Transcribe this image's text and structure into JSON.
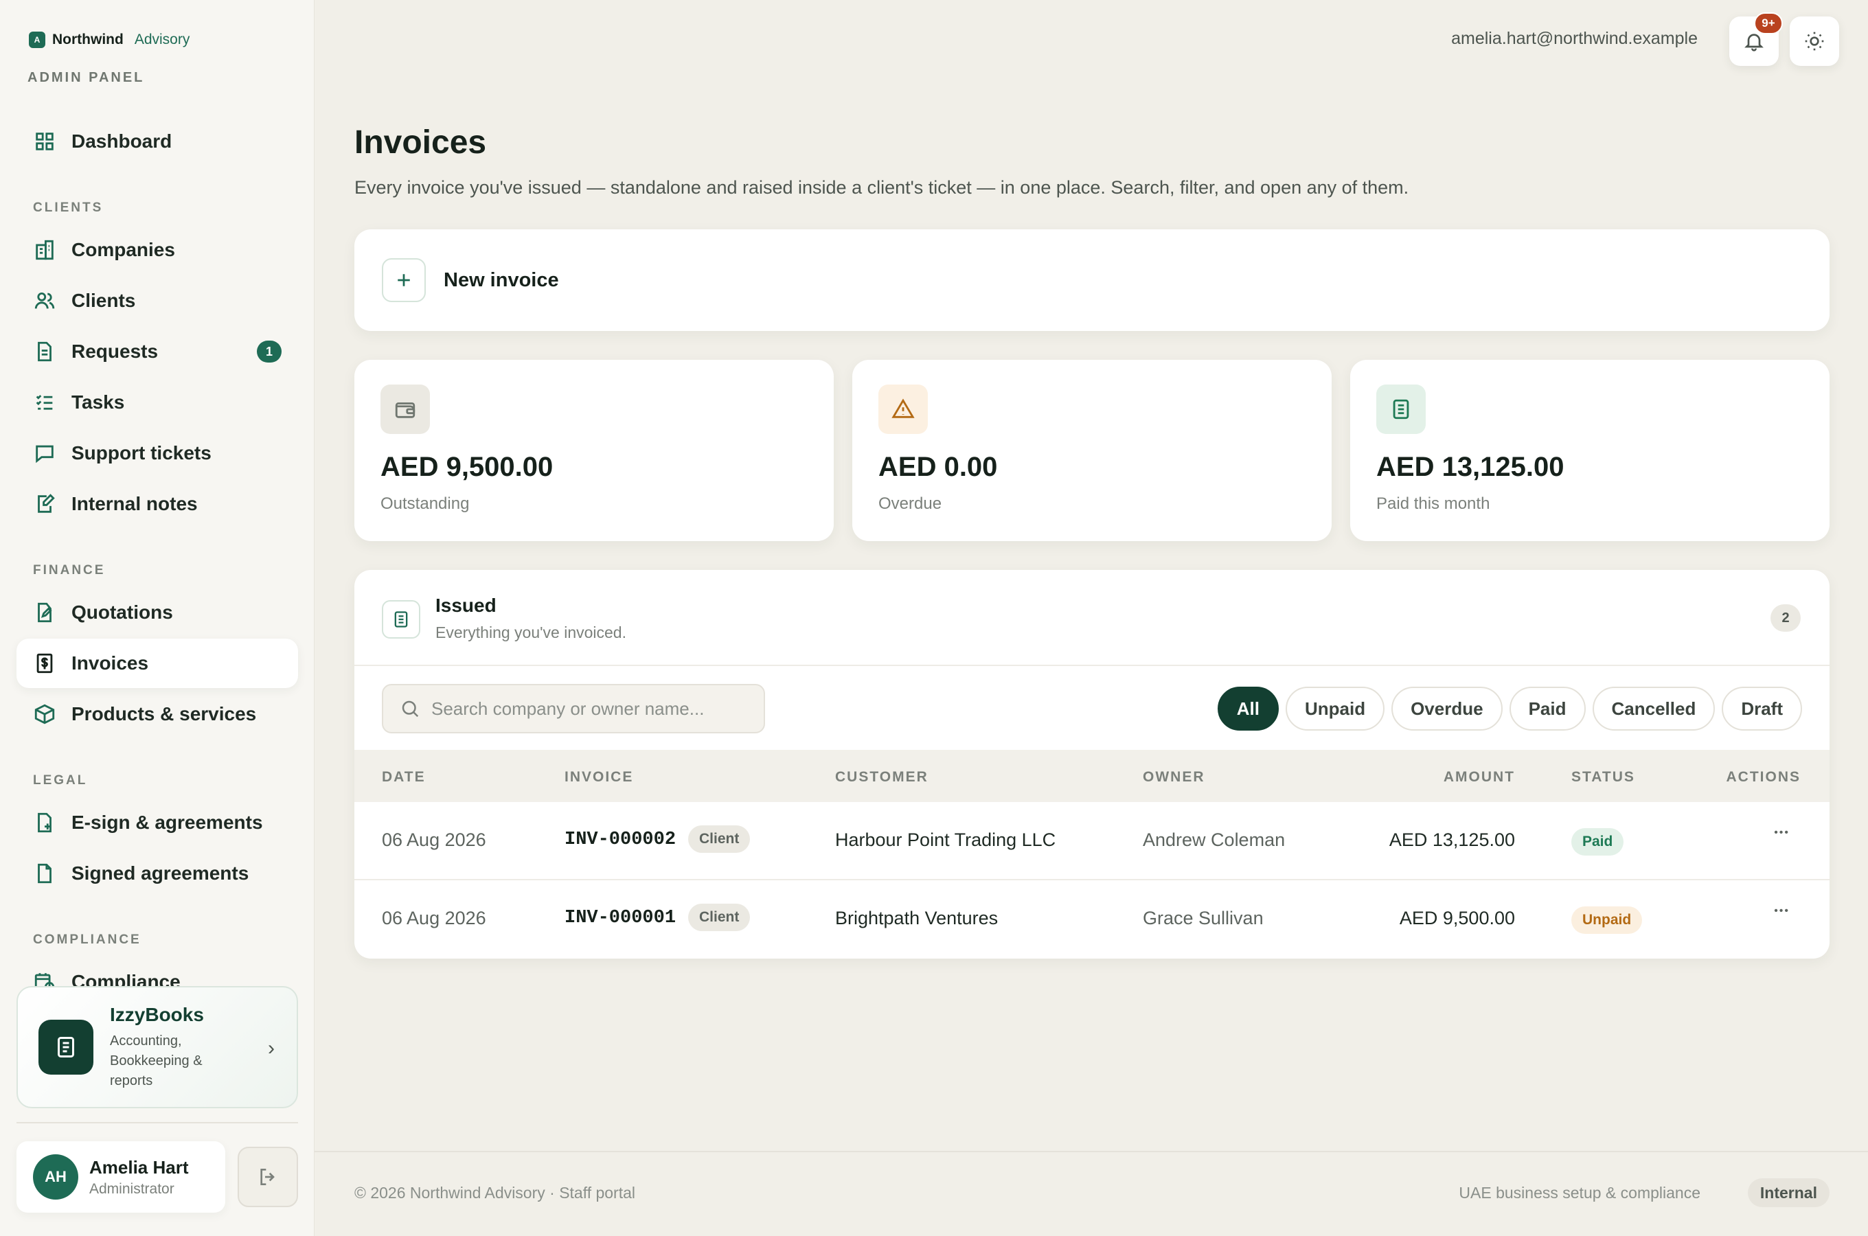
{
  "brand": {
    "name": "Northwind",
    "sub": "Advisory",
    "mark": "A",
    "panel_label": "ADMIN PANEL"
  },
  "sidebar": {
    "sections": [
      {
        "label": "",
        "items": [
          {
            "label": "Dashboard",
            "icon": "grid-icon"
          }
        ]
      },
      {
        "label": "CLIENTS",
        "items": [
          {
            "label": "Companies",
            "icon": "building-icon"
          },
          {
            "label": "Clients",
            "icon": "users-icon"
          },
          {
            "label": "Requests",
            "icon": "document-icon",
            "badge": "1"
          },
          {
            "label": "Tasks",
            "icon": "checklist-icon"
          },
          {
            "label": "Support tickets",
            "icon": "chat-icon"
          },
          {
            "label": "Internal notes",
            "icon": "edit-note-icon"
          }
        ]
      },
      {
        "label": "FINANCE",
        "items": [
          {
            "label": "Quotations",
            "icon": "edit-file-icon"
          },
          {
            "label": "Invoices",
            "icon": "dollar-file-icon",
            "active": true
          },
          {
            "label": "Products & services",
            "icon": "box-icon"
          }
        ]
      },
      {
        "label": "LEGAL",
        "items": [
          {
            "label": "E-sign & agreements",
            "icon": "file-plus-icon"
          },
          {
            "label": "Signed agreements",
            "icon": "file-icon"
          }
        ]
      },
      {
        "label": "COMPLIANCE",
        "items": [
          {
            "label": "Compliance",
            "icon": "calendar-clock-icon"
          }
        ]
      }
    ],
    "promo": {
      "title": "IzzyBooks",
      "desc": "Accounting, Bookkeeping & reports"
    },
    "user": {
      "initials": "AH",
      "name": "Amelia Hart",
      "role": "Administrator"
    }
  },
  "topbar": {
    "email": "amelia.hart@northwind.example",
    "notif_count": "9+"
  },
  "page": {
    "title": "Invoices",
    "subtitle": "Every invoice you've issued — standalone and raised inside a client's ticket — in one place. Search, filter, and open any of them."
  },
  "new_invoice": {
    "label": "New invoice"
  },
  "stats": [
    {
      "amount": "AED 9,500.00",
      "label": "Outstanding",
      "icon": "wallet-icon",
      "bg": "#ebe9e2",
      "stroke": "#6f766f"
    },
    {
      "amount": "AED 0.00",
      "label": "Overdue",
      "icon": "warning-icon",
      "bg": "#fcf0e1",
      "stroke": "#b36a14"
    },
    {
      "amount": "AED 13,125.00",
      "label": "Paid this month",
      "icon": "receipt-icon",
      "bg": "#e3f1e8",
      "stroke": "#1e7a55"
    }
  ],
  "issued": {
    "title": "Issued",
    "subtitle": "Everything you've invoiced.",
    "count": "2",
    "search_placeholder": "Search company or owner name...",
    "filters": [
      "All",
      "Unpaid",
      "Overdue",
      "Paid",
      "Cancelled",
      "Draft"
    ],
    "active_filter": "All",
    "columns": [
      "DATE",
      "INVOICE",
      "CUSTOMER",
      "OWNER",
      "AMOUNT",
      "STATUS",
      "ACTIONS"
    ],
    "rows": [
      {
        "date": "06 Aug 2026",
        "invoice": "INV-000002",
        "tag": "Client",
        "customer": "Harbour Point Trading LLC",
        "owner": "Andrew Coleman",
        "amount": "AED 13,125.00",
        "status": "Paid"
      },
      {
        "date": "06 Aug 2026",
        "invoice": "INV-000001",
        "tag": "Client",
        "customer": "Brightpath Ventures",
        "owner": "Grace Sullivan",
        "amount": "AED 9,500.00",
        "status": "Unpaid"
      }
    ]
  },
  "footer": {
    "left": "© 2026 Northwind Advisory · Staff portal",
    "right": "UAE business setup & compliance",
    "tag": "Internal"
  }
}
